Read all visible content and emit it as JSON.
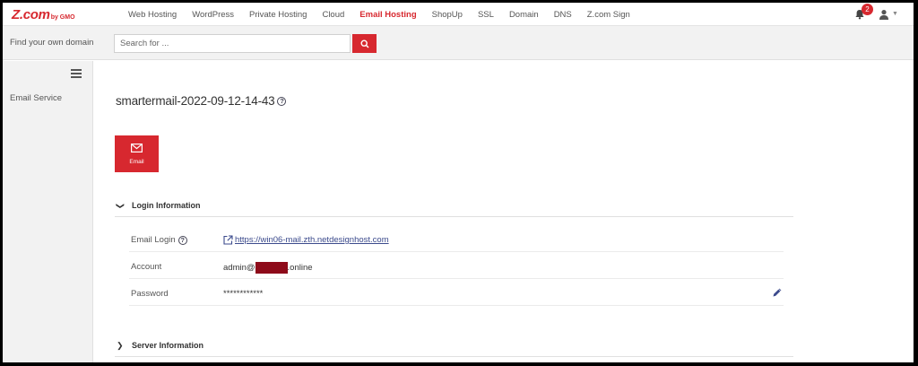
{
  "brand": {
    "logo_main": "Z.com",
    "logo_sub": "by GMO",
    "accent": "#d7282f"
  },
  "nav": {
    "items": [
      "Web Hosting",
      "WordPress",
      "Private Hosting",
      "Cloud",
      "Email Hosting",
      "ShopUp",
      "SSL",
      "Domain",
      "DNS",
      "Z.com Sign"
    ],
    "active": "Email Hosting"
  },
  "notifications": {
    "count": "2",
    "icon": "bell-icon"
  },
  "user": {
    "icon": "user-icon"
  },
  "search": {
    "label": "Find your own domain",
    "placeholder": "Search for ..."
  },
  "sidebar": {
    "items": [
      {
        "label": "Email Service"
      }
    ]
  },
  "main": {
    "title": "smartermail-2022-09-12-14-43",
    "tile_label": "Email",
    "sections": [
      {
        "label": "Login Information",
        "expanded": true,
        "rows": [
          {
            "label": "Email Login",
            "value": "https://win06-mail.zth.netdesignhost.com"
          },
          {
            "label": "Account",
            "value_prefix": "admin@",
            "value_suffix": ".online"
          },
          {
            "label": "Password",
            "value": "************"
          }
        ]
      },
      {
        "label": "Server Information",
        "expanded": false
      }
    ]
  }
}
